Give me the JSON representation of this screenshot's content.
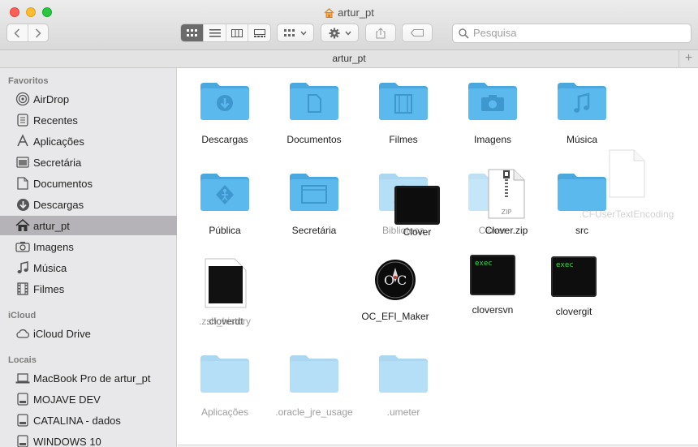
{
  "window": {
    "title": "artur_pt",
    "path_bar": "artur_pt"
  },
  "toolbar": {
    "back_icon": "chevron-left-icon",
    "forward_icon": "chevron-right-icon",
    "view_modes": [
      "icon-view",
      "list-view",
      "column-view",
      "gallery-view"
    ],
    "active_view": "icon-view",
    "search_placeholder": "Pesquisa"
  },
  "sidebar": {
    "favorites_title": "Favoritos",
    "favorites": [
      {
        "label": "AirDrop",
        "icon": "airdrop-icon"
      },
      {
        "label": "Recentes",
        "icon": "clock-icon"
      },
      {
        "label": "Aplicações",
        "icon": "apps-icon"
      },
      {
        "label": "Secretária",
        "icon": "desktop-icon"
      },
      {
        "label": "Documentos",
        "icon": "document-icon"
      },
      {
        "label": "Descargas",
        "icon": "download-icon"
      },
      {
        "label": "artur_pt",
        "icon": "home-icon",
        "selected": true
      },
      {
        "label": "Imagens",
        "icon": "camera-icon"
      },
      {
        "label": "Música",
        "icon": "music-icon"
      },
      {
        "label": "Filmes",
        "icon": "film-icon"
      }
    ],
    "icloud_title": "iCloud",
    "icloud": [
      {
        "label": "iCloud Drive",
        "icon": "cloud-icon"
      }
    ],
    "locations_title": "Locais",
    "locations": [
      {
        "label": "MacBook Pro de artur_pt",
        "icon": "laptop-icon"
      },
      {
        "label": "MOJAVE DEV",
        "icon": "disk-icon"
      },
      {
        "label": "CATALINA - dados",
        "icon": "disk-icon"
      },
      {
        "label": "WINDOWS 10",
        "icon": "disk-icon"
      }
    ]
  },
  "files": {
    "descargas": "Descargas",
    "documentos": "Documentos",
    "filmes": "Filmes",
    "imagens": "Imagens",
    "musica": "Música",
    "cfuser": ".CFUserTextEncoding",
    "publica": "Pública",
    "secretaria": "Secretária",
    "biblioteca": "Biblioteca",
    "clover": "Clover",
    "clover_zip_under": "Clover",
    "clover_zip": "Clover.zip",
    "src": "src",
    "zsh_history": ".zsh_history",
    "cloverdt": ".cloverdt",
    "oc_efi": "OC_EFI_Maker",
    "cloversvn": "cloversvn",
    "clovergit": "clovergit",
    "exec_label": "exec",
    "aplicacoes": "Aplicações",
    "oracle": ".oracle_jre_usage",
    "umeter": ".umeter"
  },
  "colors": {
    "folder": "#5cb9ee",
    "folder_tab": "#4aa8df",
    "selected_sidebar": "#b5b3b7"
  }
}
